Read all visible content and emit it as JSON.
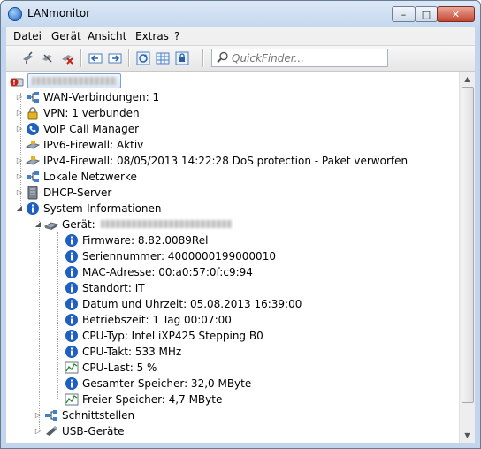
{
  "window": {
    "title": "LANmonitor",
    "min_glyph": "–",
    "max_glyph": "□",
    "close_glyph": "✕"
  },
  "menu": [
    "Datei",
    "Gerät",
    "Ansicht",
    "Extras",
    "?"
  ],
  "search": {
    "placeholder": "QuickFinder..."
  },
  "scroll": {
    "up": "▲",
    "down": "▼"
  },
  "tree": {
    "root_name": "",
    "items": [
      {
        "icon": "network-icon",
        "label": "WAN-Verbindungen: 1"
      },
      {
        "icon": "lock-icon",
        "label": "VPN: 1 verbunden"
      },
      {
        "icon": "phone-icon",
        "label": "VoIP Call Manager"
      },
      {
        "icon": "firewall-icon",
        "label": "IPv6-Firewall: Aktiv"
      },
      {
        "icon": "firewall-icon",
        "label": "IPv4-Firewall: 08/05/2013 14:22:28 DoS protection - Paket verworfen"
      },
      {
        "icon": "network-icon",
        "label": "Lokale Netzwerke"
      },
      {
        "icon": "server-icon",
        "label": "DHCP-Server"
      },
      {
        "icon": "info-icon",
        "label": "System-Informationen"
      }
    ],
    "device_label": "Gerät:",
    "device_children": [
      {
        "icon": "info-icon",
        "label": "Firmware: 8.82.0089Rel"
      },
      {
        "icon": "info-icon",
        "label": "Seriennummer: 4000000199000010"
      },
      {
        "icon": "info-icon",
        "label": "MAC-Adresse: 00:a0:57:0f:c9:94"
      },
      {
        "icon": "info-icon",
        "label": "Standort: IT"
      },
      {
        "icon": "info-icon",
        "label": "Datum und Uhrzeit: 05.08.2013 16:39:00"
      },
      {
        "icon": "info-icon",
        "label": "Betriebszeit: 1 Tag 00:07:00"
      },
      {
        "icon": "info-icon",
        "label": "CPU-Typ: Intel iXP425 Stepping B0"
      },
      {
        "icon": "info-icon",
        "label": "CPU-Takt: 533 MHz"
      },
      {
        "icon": "chart-icon",
        "label": "CPU-Last: 5 %"
      },
      {
        "icon": "info-icon",
        "label": "Gesamter Speicher: 32,0 MByte"
      },
      {
        "icon": "chart-icon",
        "label": "Freier Speicher: 4,7 MByte"
      }
    ],
    "sub_items": [
      {
        "icon": "network-icon",
        "label": "Schnittstellen"
      },
      {
        "icon": "usb-icon",
        "label": "USB-Geräte"
      }
    ]
  },
  "glyphs": {
    "collapsed": "▷",
    "expanded": "◢"
  },
  "colors": {
    "info_blue": "#1f5fbf",
    "alert_red": "#c0231a",
    "selection": "#dbe8f8"
  }
}
